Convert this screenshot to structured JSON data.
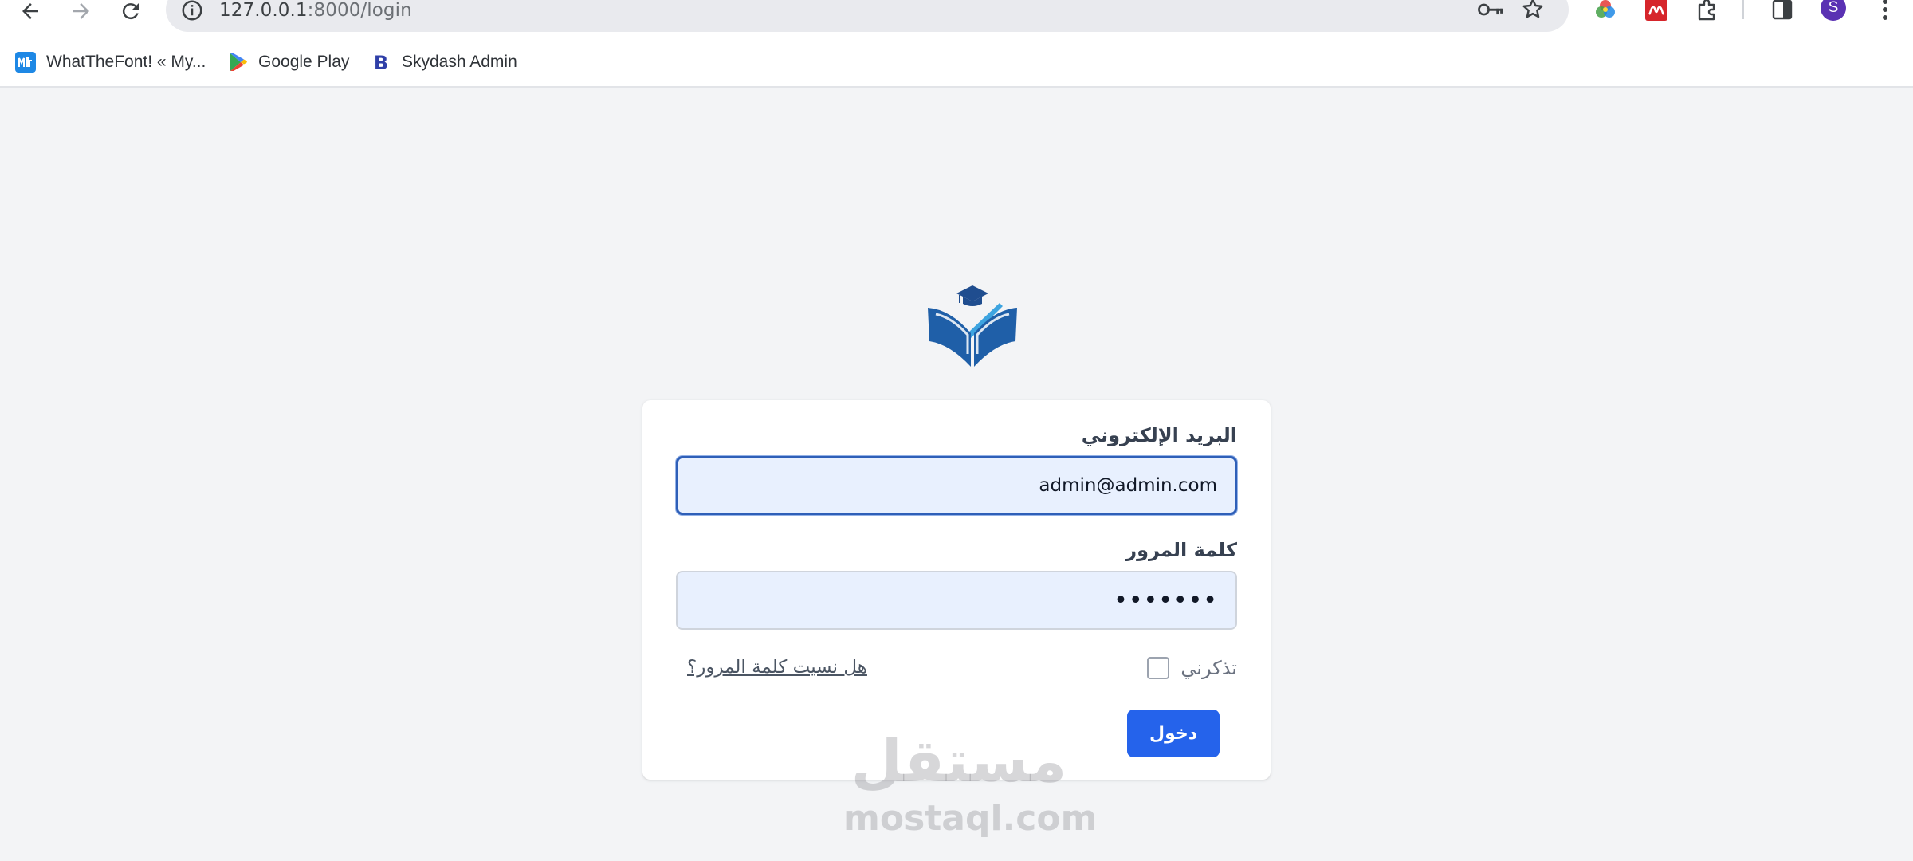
{
  "browser": {
    "url_host": "127.0.0.1",
    "url_rest": ":8000/login",
    "avatar_letter": "S",
    "colors": {
      "avatar": "#5a31b3",
      "omnibox": "#e9eaee"
    },
    "icons": [
      "back-arrow-icon",
      "forward-arrow-icon",
      "reload-icon",
      "site-info-icon",
      "password-key-icon",
      "bookmark-star-icon",
      "color-wheel-extension-icon",
      "mendeley-extension-icon",
      "extensions-puzzle-icon",
      "side-panel-icon",
      "profile-avatar",
      "kebab-menu-icon"
    ]
  },
  "bookmarks": [
    {
      "label": "WhatTheFont! « My...",
      "icon": "whatthefont-icon"
    },
    {
      "label": "Google Play",
      "icon": "google-play-icon"
    },
    {
      "label": "Skydash Admin",
      "icon": "skydash-b-icon"
    }
  ],
  "login": {
    "email_label": "البريد الإلكتروني",
    "email_value": "admin@admin.com",
    "password_label": "كلمة المرور",
    "password_value": "•••••••",
    "remember_label": "تذكرني",
    "forgot_label": "هل نسيت كلمة المرور؟",
    "submit_label": "دخول",
    "colors": {
      "primary": "#2563eb",
      "field_bg": "#e8f0fe",
      "focus_border": "#2e5fb8"
    }
  },
  "watermark": {
    "arabic": "مستقل",
    "latin": "mostaql.com"
  }
}
